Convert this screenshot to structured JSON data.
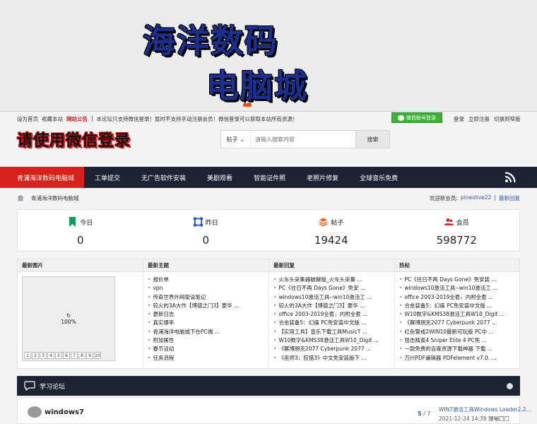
{
  "banner": {
    "line1": "海洋数码",
    "line2": "电脑城"
  },
  "toplinks": {
    "set_home": "设为首页",
    "favorite": "收藏本站",
    "notice_title": "网站公告",
    "notice_text": "本论坛只支持微信登录！暂时不支持手动注册会员！微信登录可以获取本站所有资源！"
  },
  "wechat_login_button": "微信账号登录",
  "userlinks": {
    "login": "登录",
    "register": "立即注册",
    "switch_width": "切换到窄版"
  },
  "wechat_notice": "请使用微信登录",
  "search": {
    "scope": "帖子",
    "placeholder": "请输入搜索内容",
    "button": "搜索"
  },
  "nav": {
    "items": [
      "青浦海洋数码电脑城",
      "工单提交",
      "无广告软件安装",
      "美剧观看",
      "智能证件照",
      "老照片修复",
      "全球音乐免费"
    ]
  },
  "breadcrumb": {
    "current": "青浦海洋数码电脑城",
    "welcome": "欢迎新会员:",
    "new_user": "pineolive22",
    "latest_reply": "最新回复"
  },
  "stats": [
    {
      "label": "今日",
      "value": "0"
    },
    {
      "label": "昨日",
      "value": "0"
    },
    {
      "label": "帖子",
      "value": "19424"
    },
    {
      "label": "会员",
      "value": "598772"
    }
  ],
  "panel": {
    "heads": [
      "最新图片",
      "最新主题",
      "最新回复",
      "热帖"
    ],
    "loading": "100%",
    "pages": [
      "1",
      "2",
      "3",
      "4",
      "5",
      "6",
      "7",
      "8",
      "9",
      "10"
    ],
    "latest_topics": [
      "报价单",
      "vpn",
      "传奇世界外网架设笔记",
      "较火的3A大作【博德之门3】豪华 ...",
      "更新日志",
      "真实爆率",
      "青浦海洋电脑城下在PC端 ...",
      "附加属性",
      "春节活动",
      "任务流程"
    ],
    "latest_replies": [
      "火车头采集器破解版_火车头采集 ...",
      "PC《往日不再 Days Gone》免安 ...",
      "windows10激活工具--win10激活工 ...",
      "较火的3A大作【博德之门3】豪华 ...",
      "office 2003-2019全套，内附全套 ...",
      "合金装备5：幻痛 PC免安装中文版 ...",
      "【实用工具】音乐下载工具MusicT ...",
      "W10数字&KMS38激活工具W10_Digit ...",
      "《赛博朋克2077 Cyberpunk 2077 ...",
      "《巫师3：狂猎3》中文免安装版下 ..."
    ],
    "hot_posts": [
      "PC《往日不再 Days Gone》免安装 ...",
      "windows10激活工具--win10激活工 ...",
      "office 2003-2019全套，内附全套 ...",
      "合金装备5：幻痛 PC免安装中文版 ...",
      "W10数字&KMS38激活工具W10_Digit ...",
      "《赛博朋克2077 Cyberpunk 2077 ...",
      "红色警戒2WIN10最新可玩版 PC中 ...",
      "狙击精英4 Sniper Elite 4 PC免 ...",
      "一款免费的百度资源下载神器 下载 ...",
      "万兴PDF编辑器 PDFelement v7.0. ..."
    ]
  },
  "forum_section": {
    "title": "学习论坛"
  },
  "forum_row": {
    "name": "windows7",
    "threads": "5",
    "posts": "7",
    "last_title": "WIN7激活工具Windows Loader2.2...",
    "last_time": "2021-12-24 14:39 镶嘣囗囗"
  },
  "colors": {
    "nav_bg": "#1c2332",
    "nav_active": "#d7221b",
    "banner_text": "#1c2f8e",
    "wechat_green": "#3fb03a"
  }
}
